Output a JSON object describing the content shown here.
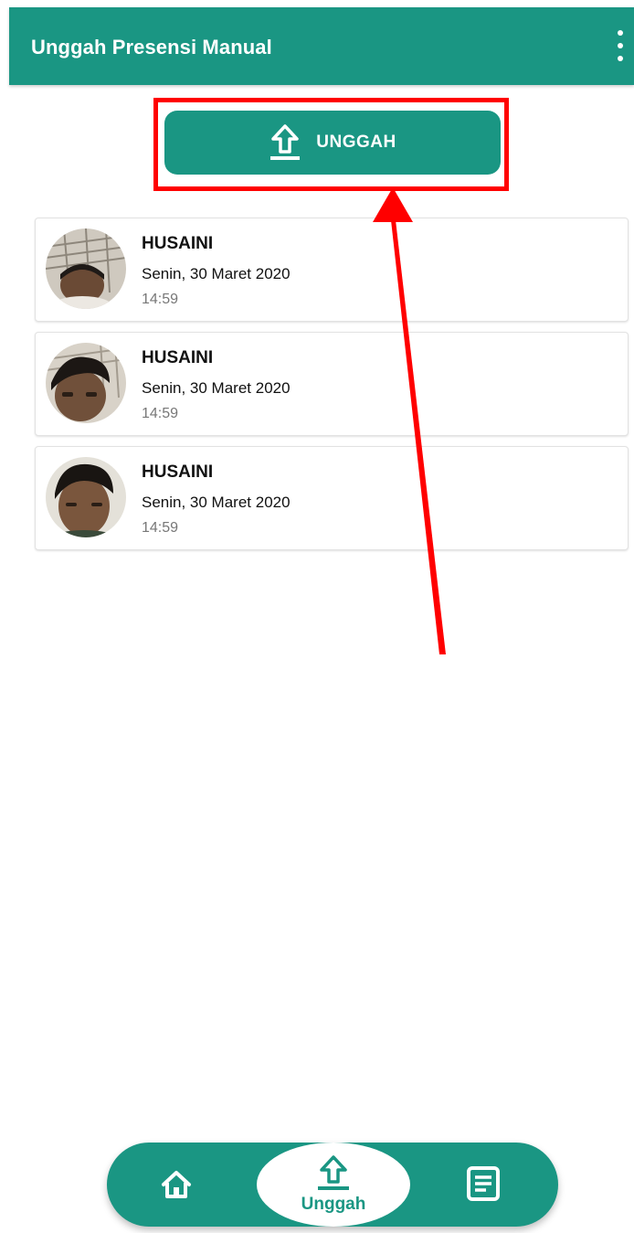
{
  "appbar": {
    "title": "Unggah Presensi Manual",
    "menu_icon": "more-vertical-icon"
  },
  "upload_button": {
    "label": "UNGGAH",
    "icon": "upload-icon"
  },
  "records": [
    {
      "name": "HUSAINI",
      "date": "Senin, 30 Maret 2020",
      "time": "14:59"
    },
    {
      "name": "HUSAINI",
      "date": "Senin, 30 Maret 2020",
      "time": "14:59"
    },
    {
      "name": "HUSAINI",
      "date": "Senin, 30 Maret 2020",
      "time": "14:59"
    }
  ],
  "bottom_nav": {
    "items": [
      {
        "icon": "home-icon",
        "label": ""
      },
      {
        "icon": "upload-icon",
        "label": "Unggah",
        "active": true
      },
      {
        "icon": "report-icon",
        "label": ""
      }
    ]
  },
  "colors": {
    "primary": "#1a9683",
    "annotation": "#ff0000",
    "background": "#ffffff"
  }
}
